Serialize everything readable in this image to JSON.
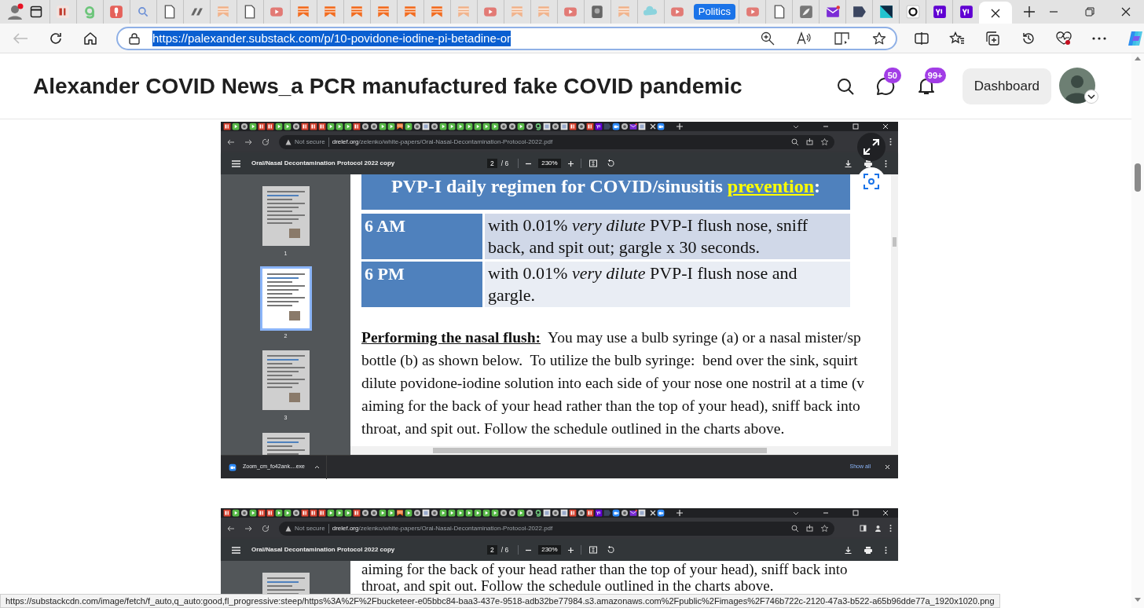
{
  "browser": {
    "tabs": [
      {
        "kind": "tab",
        "selected": false
      },
      {
        "kind": "tab",
        "selected": false
      },
      {
        "kind": "tab",
        "selected": false
      },
      {
        "kind": "tab",
        "selected": false
      },
      {
        "kind": "tab",
        "selected": false
      },
      {
        "kind": "tab",
        "selected": false
      },
      {
        "kind": "tab",
        "selected": false
      },
      {
        "kind": "tab",
        "selected": false
      },
      {
        "kind": "tab",
        "selected": false
      },
      {
        "kind": "tab",
        "selected": false
      },
      {
        "kind": "tab",
        "selected": false
      },
      {
        "kind": "tab",
        "selected": false
      },
      {
        "kind": "tab",
        "selected": false
      },
      {
        "kind": "tab",
        "selected": false
      },
      {
        "kind": "tab",
        "selected": false
      },
      {
        "kind": "tab",
        "selected": false
      },
      {
        "kind": "tab",
        "selected": false
      },
      {
        "kind": "tab",
        "selected": false
      },
      {
        "kind": "tab",
        "selected": false
      },
      {
        "kind": "tab",
        "selected": false
      },
      {
        "kind": "tab",
        "selected": false
      },
      {
        "kind": "tab",
        "selected": false
      },
      {
        "kind": "tab",
        "selected": false
      },
      {
        "kind": "tab",
        "selected": false
      },
      {
        "kind": "group",
        "label": "Politics"
      },
      {
        "kind": "tab",
        "selected": false
      },
      {
        "kind": "tab",
        "selected": false
      },
      {
        "kind": "tab",
        "selected": false
      },
      {
        "kind": "tab",
        "selected": false
      },
      {
        "kind": "tab",
        "selected": false
      },
      {
        "kind": "tab",
        "selected": false
      },
      {
        "kind": "tab",
        "selected": false
      },
      {
        "kind": "tab",
        "selected": false
      },
      {
        "kind": "tab",
        "selected": false
      },
      {
        "kind": "tab",
        "selected": true
      }
    ],
    "address": "https://palexander.substack.com/p/10-povidone-iodine-pi-betadine-or",
    "status_url": "https://substackcdn.com/image/fetch/f_auto,q_auto:good,fl_progressive:steep/https%3A%2F%2Fbucketeer-e05bbc84-baa3-437e-9518-adb32be77984.s3.amazonaws.com%2Fpublic%2Fimages%2F746b722c-2120-47a3-b522-a65b96dde77a_1920x1020.png"
  },
  "page": {
    "title": "Alexander COVID News_a PCR manufactured fake COVID pandemic",
    "messages_badge": "50",
    "notifications_badge": "99+",
    "dashboard": "Dashboard"
  },
  "screenshots": [
    {
      "not_secure": "Not secure",
      "domain": "drelef.org",
      "path": "/zelenko/white-papers/Oral-Nasal-Decontamination-Protocol-2022.pdf",
      "pdf_title": "Oral/Nasal Decontamination Protocol 2022 copy",
      "page": "2",
      "pages": "/ 6",
      "zoom": "230%",
      "thumbnails": [
        {
          "label": "1",
          "selected": false
        },
        {
          "label": "2",
          "selected": true
        },
        {
          "label": "3",
          "selected": false
        },
        {
          "selected": false
        }
      ],
      "document": {
        "heading": {
          "text": "PVP-I daily regimen for COVID/sinusitis ",
          "link": "prevention",
          "end": ":"
        },
        "rows": [
          {
            "time": "6 AM",
            "text": "with 0.01% *very dilute* PVP-I flush nose, sniff back, and spit out; gargle x 30 seconds."
          },
          {
            "time": "6 PM",
            "text": "with 0.01% *very dilute* PVP-I flush nose and gargle."
          }
        ],
        "lines": [
          "**Performing the nasal flush:**  You may use a bulb syringe (a) or a nasal mister/sp",
          "bottle (b) as shown below.  To utilize the bulb syringe:  bend over the sink, squirt",
          "dilute povidone-iodine solution into each side of your nose one nostril at a time (v",
          "aiming for the back of your head rather than the top of your head), sniff back into",
          "throat, and spit out. Follow the schedule outlined in the charts above."
        ]
      },
      "download": {
        "file": "Zoom_cm_fo42ank....exe",
        "show_all": "Show all"
      }
    },
    {
      "not_secure": "Not secure",
      "domain": "drelef.org",
      "path": "/zelenko/white-papers/Oral-Nasal-Decontamination-Protocol-2022.pdf",
      "pdf_title": "Oral/Nasal Decontamination Protocol 2022 copy",
      "page": "2",
      "pages": "/ 6",
      "zoom": "230%",
      "thumbnails": [
        {
          "selected": false
        }
      ],
      "document": {
        "lines": [
          "aiming for the back of your head rather than the top of your head), sniff back into",
          "throat, and spit out. Follow the schedule outlined in the charts above."
        ]
      }
    }
  ]
}
